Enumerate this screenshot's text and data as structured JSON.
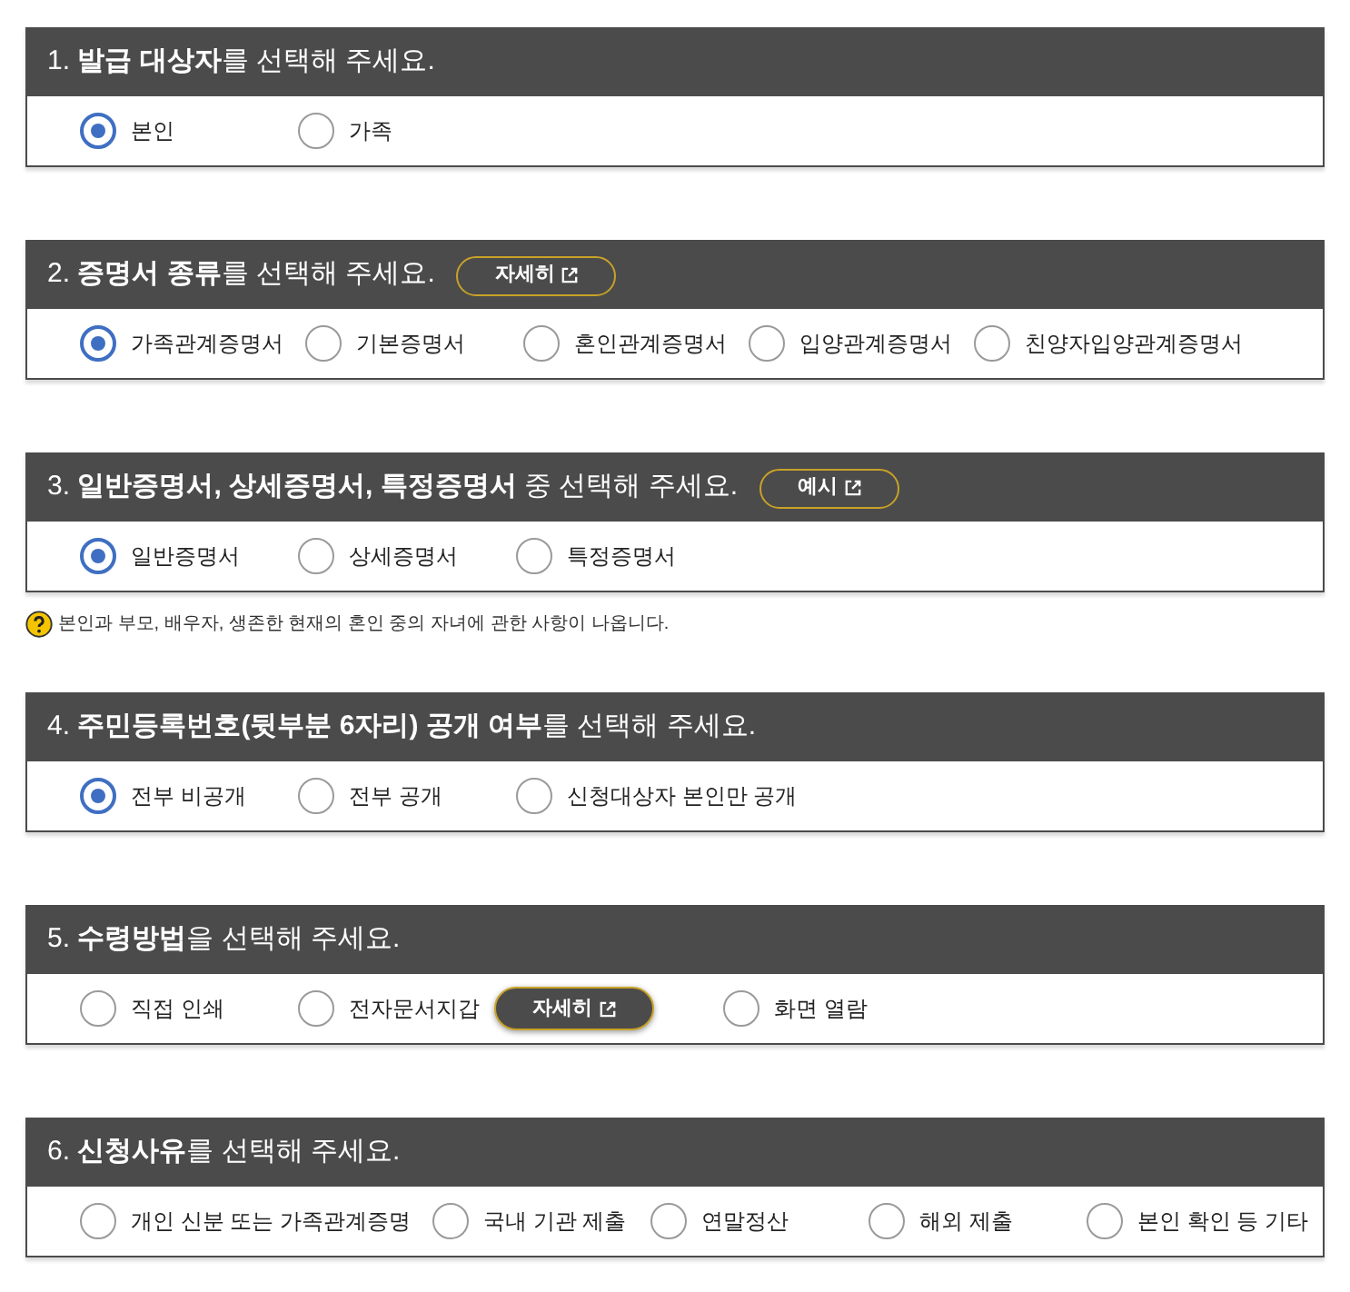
{
  "sections": [
    {
      "title": "1. **발급 대상자**를 선택해 주세요.",
      "options": [
        {
          "label": "본인",
          "selected": true
        },
        {
          "label": "가족",
          "selected": false
        }
      ]
    },
    {
      "title": "2. **증명서 종류**를 선택해 주세요.",
      "button": "자세히",
      "options": [
        {
          "label": "가족관계증명서",
          "selected": true
        },
        {
          "label": "기본증명서",
          "selected": false
        },
        {
          "label": "혼인관계증명서",
          "selected": false
        },
        {
          "label": "입양관계증명서",
          "selected": false
        },
        {
          "label": "친양자입양관계증명서",
          "selected": false
        }
      ]
    },
    {
      "title": "3. **일반증명서, 상세증명서, 특정증명서** 중 선택해 주세요.",
      "button": "예시",
      "options": [
        {
          "label": "일반증명서",
          "selected": true
        },
        {
          "label": "상세증명서",
          "selected": false
        },
        {
          "label": "특정증명서",
          "selected": false
        }
      ],
      "note": "본인과 부모, 배우자, 생존한 현재의 혼인 중의 자녀에 관한 사항이 나옵니다."
    },
    {
      "title": "4. **주민등록번호(뒷부분 6자리) 공개 여부**를 선택해 주세요.",
      "options": [
        {
          "label": "전부 비공개",
          "selected": true
        },
        {
          "label": "전부 공개",
          "selected": false
        },
        {
          "label": "신청대상자 본인만 공개",
          "selected": false
        }
      ]
    },
    {
      "title": "5. **수령방법**을 선택해 주세요.",
      "options": [
        {
          "label": "직접 인쇄",
          "selected": false
        },
        {
          "label": "전자문서지갑",
          "selected": false,
          "button": "자세히"
        },
        {
          "label": "화면 열람",
          "selected": false
        }
      ]
    },
    {
      "title": "6. **신청사유**를 선택해 주세요.",
      "options": [
        {
          "label": "개인 신분 또는 가족관계증명",
          "selected": false
        },
        {
          "label": "국내 기관 제출",
          "selected": false
        },
        {
          "label": "연말정산",
          "selected": false
        },
        {
          "label": "해외 제출",
          "selected": false
        },
        {
          "label": "본인 확인 등 기타",
          "selected": false
        }
      ]
    }
  ]
}
